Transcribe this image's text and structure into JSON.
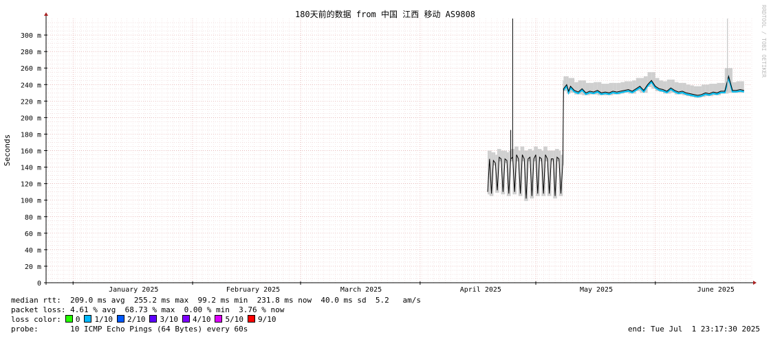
{
  "watermark": "RRDTOOL / TOBI OETIKER",
  "chart_data": {
    "type": "line",
    "title": "180天前的数据 from 中国 江西 移动 AS9808",
    "ylabel": "Seconds",
    "xlabel": "",
    "ylim": [
      0,
      320
    ],
    "yticks": [
      0,
      20,
      40,
      60,
      80,
      100,
      120,
      140,
      160,
      180,
      200,
      220,
      240,
      260,
      280,
      300
    ],
    "ytick_labels": [
      "0",
      "20 m",
      "40 m",
      "60 m",
      "80 m",
      "100 m",
      "120 m",
      "140 m",
      "160 m",
      "180 m",
      "200 m",
      "220 m",
      "240 m",
      "260 m",
      "280 m",
      "300 m"
    ],
    "y_unit": "ms",
    "x_range_day": [
      -7,
      176
    ],
    "x_unit": "days after 2025-01-01",
    "xticks": [
      {
        "label": "January 2025",
        "day": 0
      },
      {
        "label": "February 2025",
        "day": 31
      },
      {
        "label": "March 2025",
        "day": 59
      },
      {
        "label": "April 2025",
        "day": 90
      },
      {
        "label": "May 2025",
        "day": 120
      },
      {
        "label": "June 2025",
        "day": 151
      }
    ],
    "grid": true,
    "series": [
      {
        "name": "median rtt",
        "color": "#000000",
        "points": [
          [
            107.5,
            110
          ],
          [
            108,
            150
          ],
          [
            108.5,
            108
          ],
          [
            109,
            148
          ],
          [
            109.5,
            145
          ],
          [
            110,
            112
          ],
          [
            110.5,
            152
          ],
          [
            111,
            150
          ],
          [
            111.5,
            110
          ],
          [
            112,
            150
          ],
          [
            112.5,
            148
          ],
          [
            113,
            108
          ],
          [
            113.5,
            150
          ],
          [
            114,
            152
          ],
          [
            114.5,
            110
          ],
          [
            115,
            155
          ],
          [
            115.5,
            150
          ],
          [
            116,
            108
          ],
          [
            116.5,
            155
          ],
          [
            117,
            150
          ],
          [
            117.5,
            102
          ],
          [
            118,
            150
          ],
          [
            118.5,
            152
          ],
          [
            119,
            105
          ],
          [
            119.5,
            150
          ],
          [
            120,
            155
          ],
          [
            120.5,
            108
          ],
          [
            121,
            152
          ],
          [
            121.5,
            150
          ],
          [
            122,
            108
          ],
          [
            122.5,
            155
          ],
          [
            123,
            150
          ],
          [
            123.5,
            108
          ],
          [
            124,
            150
          ],
          [
            124.5,
            150
          ],
          [
            125,
            105
          ],
          [
            125.5,
            152
          ],
          [
            126,
            150
          ],
          [
            126.5,
            108
          ],
          [
            127,
            145
          ],
          [
            127.2,
            235
          ],
          [
            128,
            240
          ],
          [
            128.5,
            232
          ],
          [
            129,
            238
          ],
          [
            130,
            233
          ],
          [
            131,
            231
          ],
          [
            132,
            235
          ],
          [
            133,
            230
          ],
          [
            134,
            232
          ],
          [
            135,
            231
          ],
          [
            136,
            233
          ],
          [
            137,
            230
          ],
          [
            138,
            231
          ],
          [
            139,
            230
          ],
          [
            140,
            232
          ],
          [
            141,
            231
          ],
          [
            142,
            232
          ],
          [
            143,
            233
          ],
          [
            144,
            234
          ],
          [
            145,
            232
          ],
          [
            146,
            235
          ],
          [
            147,
            238
          ],
          [
            148,
            233
          ],
          [
            149,
            240
          ],
          [
            150,
            245
          ],
          [
            151,
            238
          ],
          [
            152,
            235
          ],
          [
            153,
            234
          ],
          [
            154,
            232
          ],
          [
            155,
            236
          ],
          [
            156,
            233
          ],
          [
            157,
            231
          ],
          [
            158,
            232
          ],
          [
            159,
            230
          ],
          [
            160,
            229
          ],
          [
            161,
            228
          ],
          [
            162,
            227
          ],
          [
            163,
            228
          ],
          [
            164,
            230
          ],
          [
            165,
            229
          ],
          [
            166,
            231
          ],
          [
            167,
            230
          ],
          [
            168,
            232
          ],
          [
            169,
            232
          ],
          [
            170,
            250
          ],
          [
            171,
            233
          ],
          [
            172,
            233
          ],
          [
            173,
            234
          ],
          [
            174,
            233
          ]
        ]
      }
    ],
    "spikes": [
      {
        "day": 113.5,
        "value": 185
      },
      {
        "day": 114,
        "value": 320
      }
    ],
    "loss_band": {
      "from_day": 127.2,
      "to_day": 174,
      "color": "#00bbee"
    }
  },
  "legend": {
    "median_rtt": {
      "label": "median rtt:",
      "text": "209.0 ms avg  255.2 ms max  99.2 ms min  231.8 ms now  40.0 ms sd  5.2   am/s"
    },
    "packet_loss": {
      "label": "packet loss:",
      "text": "4.61 % avg  68.73 % max  0.00 % min  3.76 % now"
    },
    "loss_color": {
      "label": "loss color:",
      "items": [
        {
          "label": "0",
          "color": "#26ff00"
        },
        {
          "label": "1/10",
          "color": "#00b8ff"
        },
        {
          "label": "2/10",
          "color": "#0059ff"
        },
        {
          "label": "3/10",
          "color": "#5e00ff"
        },
        {
          "label": "4/10",
          "color": "#7e00ff"
        },
        {
          "label": "5/10",
          "color": "#dd00ff"
        },
        {
          "label": "9/10",
          "color": "#ff0000"
        }
      ]
    },
    "probe": {
      "label": "probe:",
      "text": "10 ICMP Echo Pings (64 Bytes) every 60s"
    },
    "end": "end: Tue Jul  1 23:17:30 2025"
  }
}
